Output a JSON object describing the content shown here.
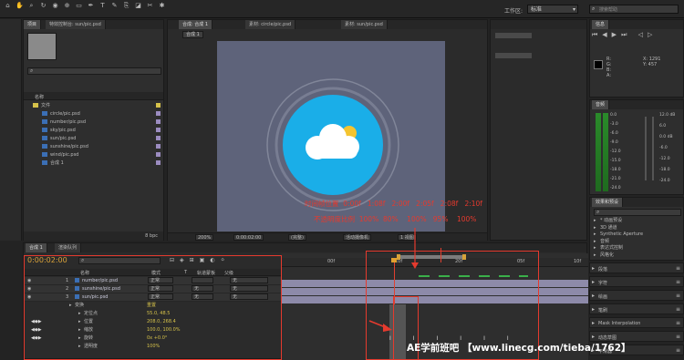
{
  "app": {
    "toolbar_icons": [
      "home-icon",
      "hand-icon",
      "zoom-icon",
      "rotate-icon",
      "camera-icon",
      "pan-behind-icon",
      "rectangle-icon",
      "pen-icon",
      "text-icon",
      "brush-icon",
      "clone-icon",
      "eraser-icon",
      "roto-icon",
      "puppet-icon"
    ],
    "workspace_label": "工作区:",
    "workspace_value": "标准",
    "search_placeholder": "搜索帮助"
  },
  "project_panel": {
    "tabs": [
      "项目",
      "特效控制台: sun/pic.psd"
    ],
    "footer": "8 bpc",
    "column_header": "名称",
    "items": [
      {
        "name": "文件",
        "type": "folder",
        "color": "#d6c24a"
      },
      {
        "name": "circle/pic.psd",
        "type": "file",
        "color": "#9b8cc0"
      },
      {
        "name": "number/pic.psd",
        "type": "file",
        "color": "#9b8cc0"
      },
      {
        "name": "sky/pic.psd",
        "type": "file",
        "color": "#9b8cc0"
      },
      {
        "name": "sun/pic.psd",
        "type": "file",
        "color": "#9b8cc0"
      },
      {
        "name": "sunshine/pic.psd",
        "type": "file",
        "color": "#9b8cc0"
      },
      {
        "name": "wind/pic.psd",
        "type": "file",
        "color": "#9b8cc0"
      },
      {
        "name": "合成 1",
        "type": "comp",
        "color": "#9b8cc0"
      }
    ]
  },
  "comp_viewer": {
    "tabs": [
      "合成: 合成 1",
      "素材: circle/pic.psd",
      "素材: sun/pic.psd"
    ],
    "subtab": "合成 1",
    "footer_items": [
      "200%",
      "0:00:02:00",
      "(完整)",
      "活动摄像机",
      "1 视图"
    ],
    "bg_color": "#5e637a",
    "circle_color": "#1aaee8"
  },
  "annotation": {
    "line1": "时间帧位置  0:00f   1:08f   2:00f   2:05f   2:08f   2:10f",
    "line2": "不透明度比例  100%  80%    100%   95%    100%"
  },
  "right_panels": {
    "info_tab": "信息",
    "audio_tab": "音频",
    "preview_tab": "预览",
    "info_values": {
      "r": "R:",
      "g": "G:",
      "b": "B:",
      "a": "A:",
      "x": "X: 1291",
      "y": "Y: 457"
    },
    "effects_tab": "效果和预设",
    "effects_items": [
      "* 动画预设",
      "3D 通道",
      "Synthetic Aperture",
      "音频",
      "表达式控制",
      "风格化"
    ],
    "collapsed": [
      "段落",
      "字符",
      "绘画",
      "笔刷",
      "动态草图"
    ],
    "interp_label": "Mask Interpolation",
    "smooth_label": "平滑器",
    "audio_scale": [
      "0.0",
      "-3.0",
      "-6.0",
      "-9.0",
      "-12.0",
      "-15.0",
      "-18.0",
      "-21.0",
      "-24.0"
    ],
    "audio_scale_r": [
      "12.0 dB",
      "6.0",
      "0.0 dB",
      "-6.0",
      "-12.0",
      "-18.0",
      "-24.0"
    ]
  },
  "timeline": {
    "tabs": [
      "合成 1",
      "渲染队列"
    ],
    "time": "0:00:02:00",
    "frame_info": "00050 (25.00 fps)",
    "columns": [
      "名称",
      "模式",
      "T",
      "轨道蒙板",
      "父级"
    ],
    "ruler": [
      "00f",
      "10f",
      "20f",
      "05f",
      "10f"
    ],
    "layers": [
      {
        "num": "1",
        "name": "number/pic.psd",
        "mode": "正常",
        "trk": "",
        "parent": "无"
      },
      {
        "num": "2",
        "name": "sunshine/pic.psd",
        "mode": "正常",
        "trk": "无",
        "parent": "无"
      },
      {
        "num": "3",
        "name": "sun/pic.psd",
        "mode": "正常",
        "trk": "无",
        "parent": "无"
      }
    ],
    "props": [
      {
        "name": "变换",
        "value": "重置"
      },
      {
        "name": "定位点",
        "value": "55.0, 48.5"
      },
      {
        "name": "位置",
        "value": "208.0, 268.4"
      },
      {
        "name": "缩放",
        "value": "100.0, 100.0%"
      },
      {
        "name": "旋转",
        "value": "0x +0.0°"
      },
      {
        "name": "透明度",
        "value": "100%"
      }
    ]
  },
  "watermark": "AE学前班吧  【www.linecg.com/tieba/1762】"
}
